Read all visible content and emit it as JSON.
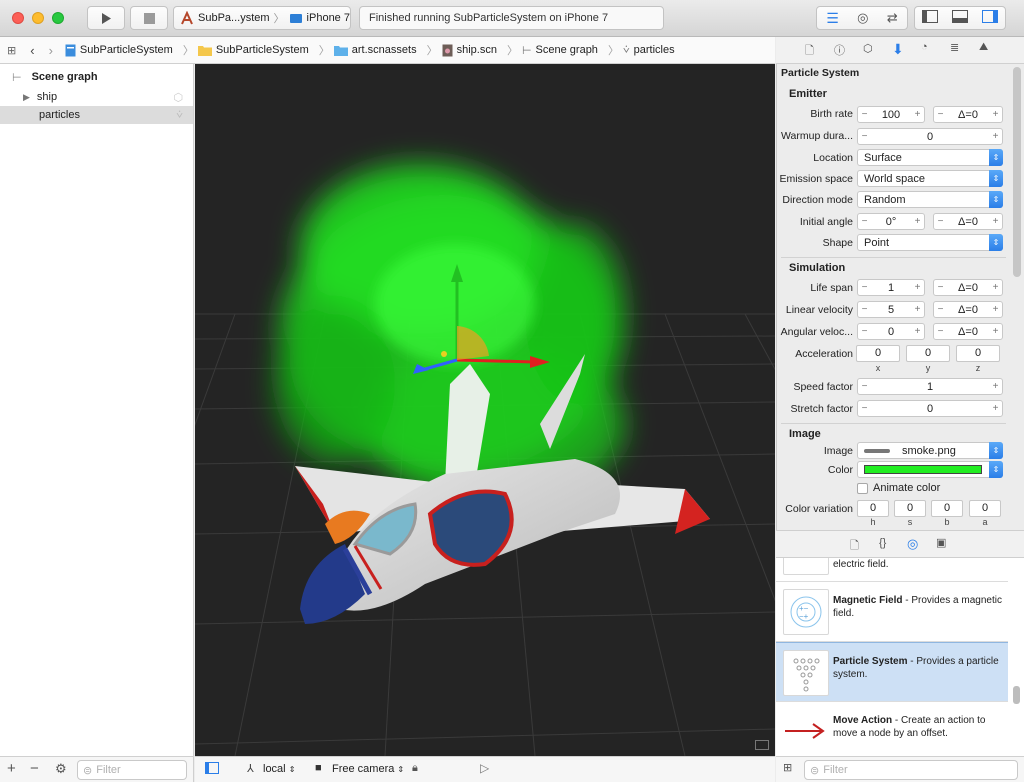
{
  "toolbar": {
    "scheme_name": "SubPa...ystem",
    "device": "iPhone 7",
    "status": "Finished running SubParticleSystem on iPhone 7"
  },
  "jumpbar": {
    "crumbs": [
      "SubParticleSystem",
      "SubParticleSystem",
      "art.scnassets",
      "ship.scn",
      "Scene graph",
      "particles"
    ]
  },
  "outline": {
    "title": "Scene graph",
    "items": [
      {
        "label": "ship"
      },
      {
        "label": "particles"
      }
    ],
    "filter_placeholder": "Filter"
  },
  "viewport_bar": {
    "transform_space": "local",
    "camera": "Free camera"
  },
  "inspector": {
    "title": "Particle System",
    "emitter": {
      "header": "Emitter",
      "birth_rate_label": "Birth rate",
      "birth_rate": "100",
      "birth_rate_delta": "Δ=0",
      "warmup_label": "Warmup dura...",
      "warmup": "0",
      "location_label": "Location",
      "location": "Surface",
      "emission_space_label": "Emission space",
      "emission_space": "World space",
      "direction_mode_label": "Direction mode",
      "direction_mode": "Random",
      "initial_angle_label": "Initial angle",
      "initial_angle": "0°",
      "initial_angle_delta": "Δ=0",
      "shape_label": "Shape",
      "shape": "Point"
    },
    "simulation": {
      "header": "Simulation",
      "life_span_label": "Life span",
      "life_span": "1",
      "life_span_delta": "Δ=0",
      "linear_velocity_label": "Linear velocity",
      "linear_velocity": "5",
      "linear_velocity_delta": "Δ=0",
      "angular_velocity_label": "Angular veloc...",
      "angular_velocity": "0",
      "angular_velocity_delta": "Δ=0",
      "acceleration_label": "Acceleration",
      "acceleration": {
        "x": "0",
        "y": "0",
        "z": "0"
      },
      "axis_labels": {
        "x": "x",
        "y": "y",
        "z": "z"
      },
      "speed_factor_label": "Speed factor",
      "speed_factor": "1",
      "stretch_factor_label": "Stretch factor",
      "stretch_factor": "0"
    },
    "image": {
      "header": "Image",
      "image_label": "Image",
      "image_name": "smoke.png",
      "color_label": "Color",
      "color": "#22ee22",
      "animate_color_label": "Animate color",
      "color_variation_label": "Color variation",
      "variation": {
        "h": "0",
        "s": "0",
        "b": "0",
        "a": "0"
      },
      "variation_labels": {
        "h": "h",
        "s": "s",
        "b": "b",
        "a": "a"
      }
    }
  },
  "library": {
    "items": [
      {
        "title": "",
        "desc": "electric field."
      },
      {
        "title": "Magnetic Field",
        "desc": " - Provides a magnetic field."
      },
      {
        "title": "Particle System",
        "desc": " - Provides a particle system."
      },
      {
        "title": "Move Action",
        "desc": " - Create an action to move a node by an offset."
      }
    ],
    "filter_placeholder": "Filter"
  },
  "colors": {
    "accent": "#2b7ee8",
    "selection": "#cde0f5",
    "particles": "#22ee22"
  }
}
